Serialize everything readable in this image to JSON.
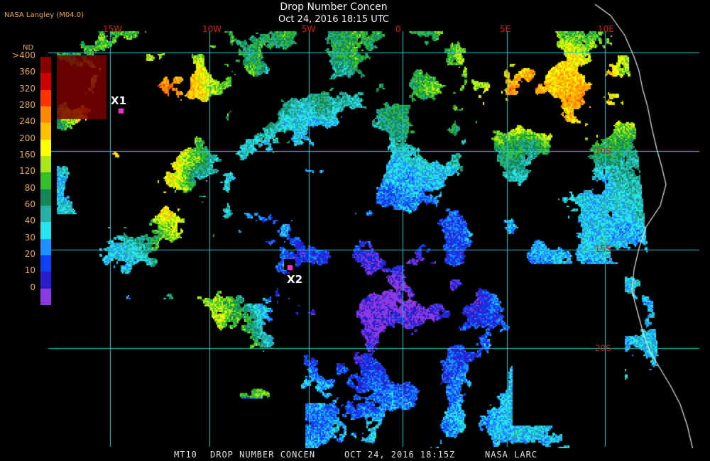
{
  "title": "Drop Number Concen",
  "subtitle": "Oct 24, 2016 18:15 UTC",
  "producer": "NASA Langley (M04.0)",
  "footer": {
    "product": "MT10",
    "name": "DROP NUMBER CONCEN",
    "datetime": "OCT 24, 2016 18:15Z",
    "source": "NASA LARC"
  },
  "legend": {
    "unit": "ND",
    "labels": [
      ">400",
      "360",
      "320",
      "280",
      "240",
      "200",
      "160",
      "120",
      "80",
      "60",
      "40",
      "30",
      "20",
      "10",
      "0"
    ],
    "colors": [
      "#8a0000",
      "#cc0000",
      "#ff3300",
      "#ff8800",
      "#ffc000",
      "#ffff00",
      "#a8e81a",
      "#34c02a",
      "#13885a",
      "#26b0a8",
      "#29e6ee",
      "#1e90ff",
      "#1040f0",
      "#2a1cc8",
      "#8a3ae0"
    ]
  },
  "longitude_labels": [
    "15W",
    "10W",
    "5W",
    "0",
    "5E",
    "10E"
  ],
  "latitude_labels": [
    "10S",
    "15S",
    "20S"
  ],
  "sites": [
    {
      "id": "X1",
      "label": "X1"
    },
    {
      "id": "X2",
      "label": "X2"
    }
  ]
}
